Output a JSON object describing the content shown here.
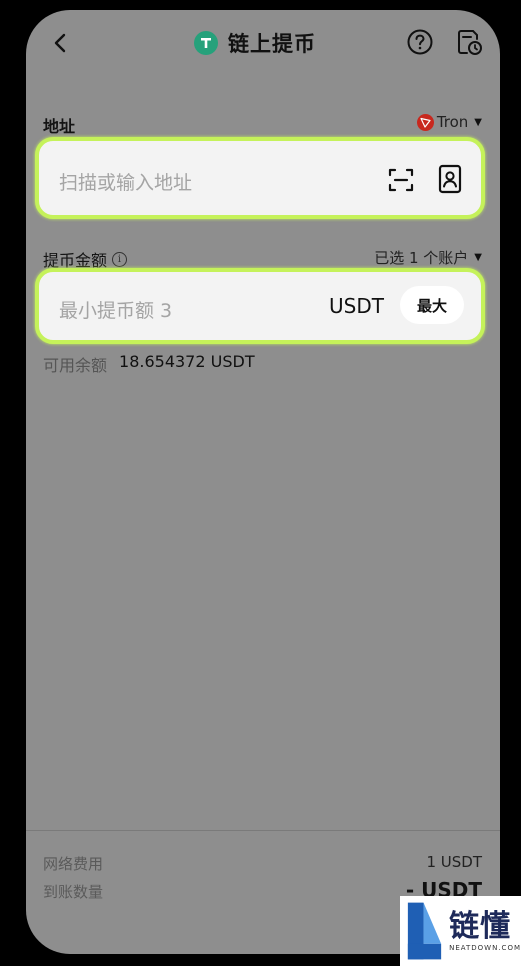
{
  "header": {
    "title": "链上提币",
    "coin_icon": "tether-icon"
  },
  "address": {
    "label": "地址",
    "network": "Tron",
    "placeholder": "扫描或输入地址"
  },
  "amount": {
    "label": "提币金额",
    "info_icon": "i",
    "account_select": "已选 1 个账户",
    "placeholder": "最小提币额 3",
    "unit": "USDT",
    "max_label": "最大"
  },
  "available": {
    "label": "可用余额",
    "value": "18.654372 USDT"
  },
  "summary": {
    "fee_label": "网络费用",
    "fee_value": "1 USDT",
    "receive_label": "到账数量",
    "receive_value": "- USDT"
  },
  "watermark": {
    "cn": "链懂",
    "en": "NEATDOWN.COM"
  },
  "colors": {
    "highlight": "#c5f25a",
    "tether": "#26a17b",
    "tron": "#c8281e"
  }
}
